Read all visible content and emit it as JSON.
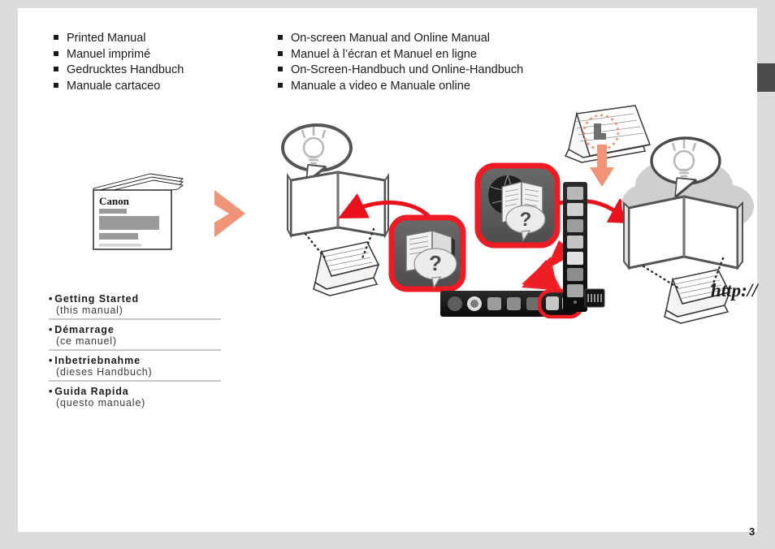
{
  "page": {
    "number": "3",
    "background_color": "#dcdcdc",
    "paper_color": "#ffffff",
    "edge_tab_color": "#4b4b4d"
  },
  "colors": {
    "accent_red": "#e8111c",
    "salmon_arrow": "#f09377",
    "gray_art": "#bfbfbf",
    "text": "#1a1a1a",
    "rule": "#c9c9c9"
  },
  "left_list": {
    "bullet": "square",
    "items": [
      "Printed Manual",
      "Manuel imprimé",
      "Gedrucktes Handbuch",
      "Manuale cartaceo"
    ]
  },
  "right_list": {
    "bullet": "square",
    "items": [
      "On-screen Manual and Online Manual",
      "Manuel à l’écran et Manuel en ligne",
      "On-Screen-Handbuch und Online-Handbuch",
      "Manuale a video e Manuale online"
    ]
  },
  "legend": {
    "bullet": "•",
    "items": [
      {
        "title": "Getting Started",
        "subtitle": "(this manual)"
      },
      {
        "title": "Démarrage",
        "subtitle": "(ce manuel)"
      },
      {
        "title": "Inbetriebnahme",
        "subtitle": "(dieses Handbuch)"
      },
      {
        "title": "Guida Rapida",
        "subtitle": "(questo manuale)"
      }
    ]
  },
  "artwork": {
    "printed_manual": {
      "brand_text": "Canon",
      "description": "printed booklet cover with Canon wordmark and gray placeholder bars"
    },
    "salmon_arrow": {
      "description": "large salmon chevron arrow pointing right"
    },
    "onscreen_scene": {
      "description": "open book with lightbulb thought bubble over a laptop",
      "book_icon_glyph": "?",
      "icon_label": "on-screen-manual-icon"
    },
    "online_scene": {
      "description": "open book in front of a cloud with lightbulb thought bubble over a laptop",
      "url_text": "http://",
      "icon_label": "online-manual-icon"
    },
    "dock": {
      "description": "desktop dock strip with application icons; two manual icons highlighted in red",
      "highlighted_count": 2
    },
    "laptop_top": {
      "description": "laptop with dotted circle highlight on cursor, salmon arrow pointing down to dock"
    }
  }
}
